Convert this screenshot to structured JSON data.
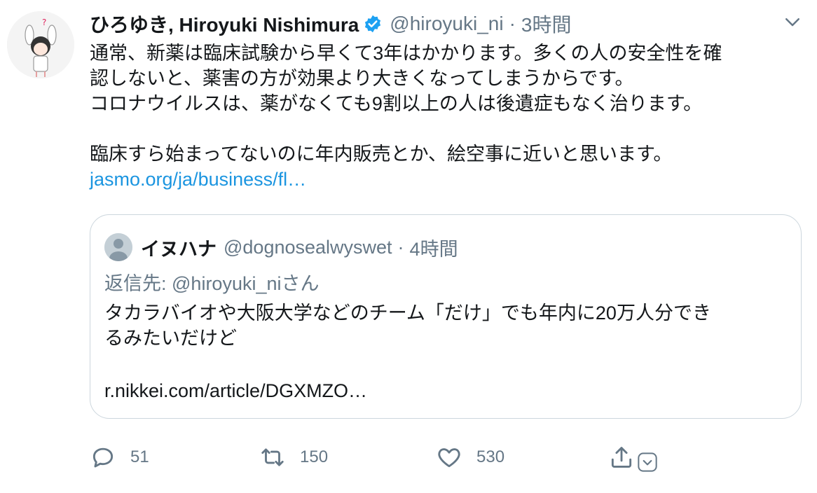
{
  "tweet": {
    "author_name": "ひろゆき, Hiroyuki Nishimura",
    "handle": "@hiroyuki_ni",
    "separator": "·",
    "time": "3時間",
    "text": "通常、新薬は臨床試験から早くて3年はかかります。多くの人の安全性を確\n認しないと、薬害の方が効果より大きくなってしまうからです。\nコロナウイルスは、薬がなくても9割以上の人は後遺症もなく治ります。\n\n臨床すら始まってないのに年内販売とか、絵空事に近いと思います。",
    "link": "jasmo.org/ja/business/fl…",
    "icons": {
      "verified": "verified-badge-icon",
      "menu": "chevron-down-icon",
      "avatar": "avatar"
    },
    "colors": {
      "link": "#1b95e0",
      "verified": "#1da1f2",
      "muted": "#657786"
    }
  },
  "quote": {
    "name": "イヌハナ",
    "handle": "@dognosealwyswet",
    "separator": "·",
    "time": "4時間",
    "reply_prefix": "返信先: ",
    "reply_handle": "@hiroyuki_ni",
    "reply_suffix": "さん",
    "text": "タカラバイオや大阪大学などのチーム「だけ」でも年内に20万人分でき\nるみたいだけど",
    "link": "r.nikkei.com/article/DGXMZO…"
  },
  "actions": {
    "reply_count": "51",
    "retweet_count": "150",
    "like_count": "530",
    "icons": [
      "reply-icon",
      "retweet-icon",
      "like-icon",
      "share-icon"
    ]
  }
}
